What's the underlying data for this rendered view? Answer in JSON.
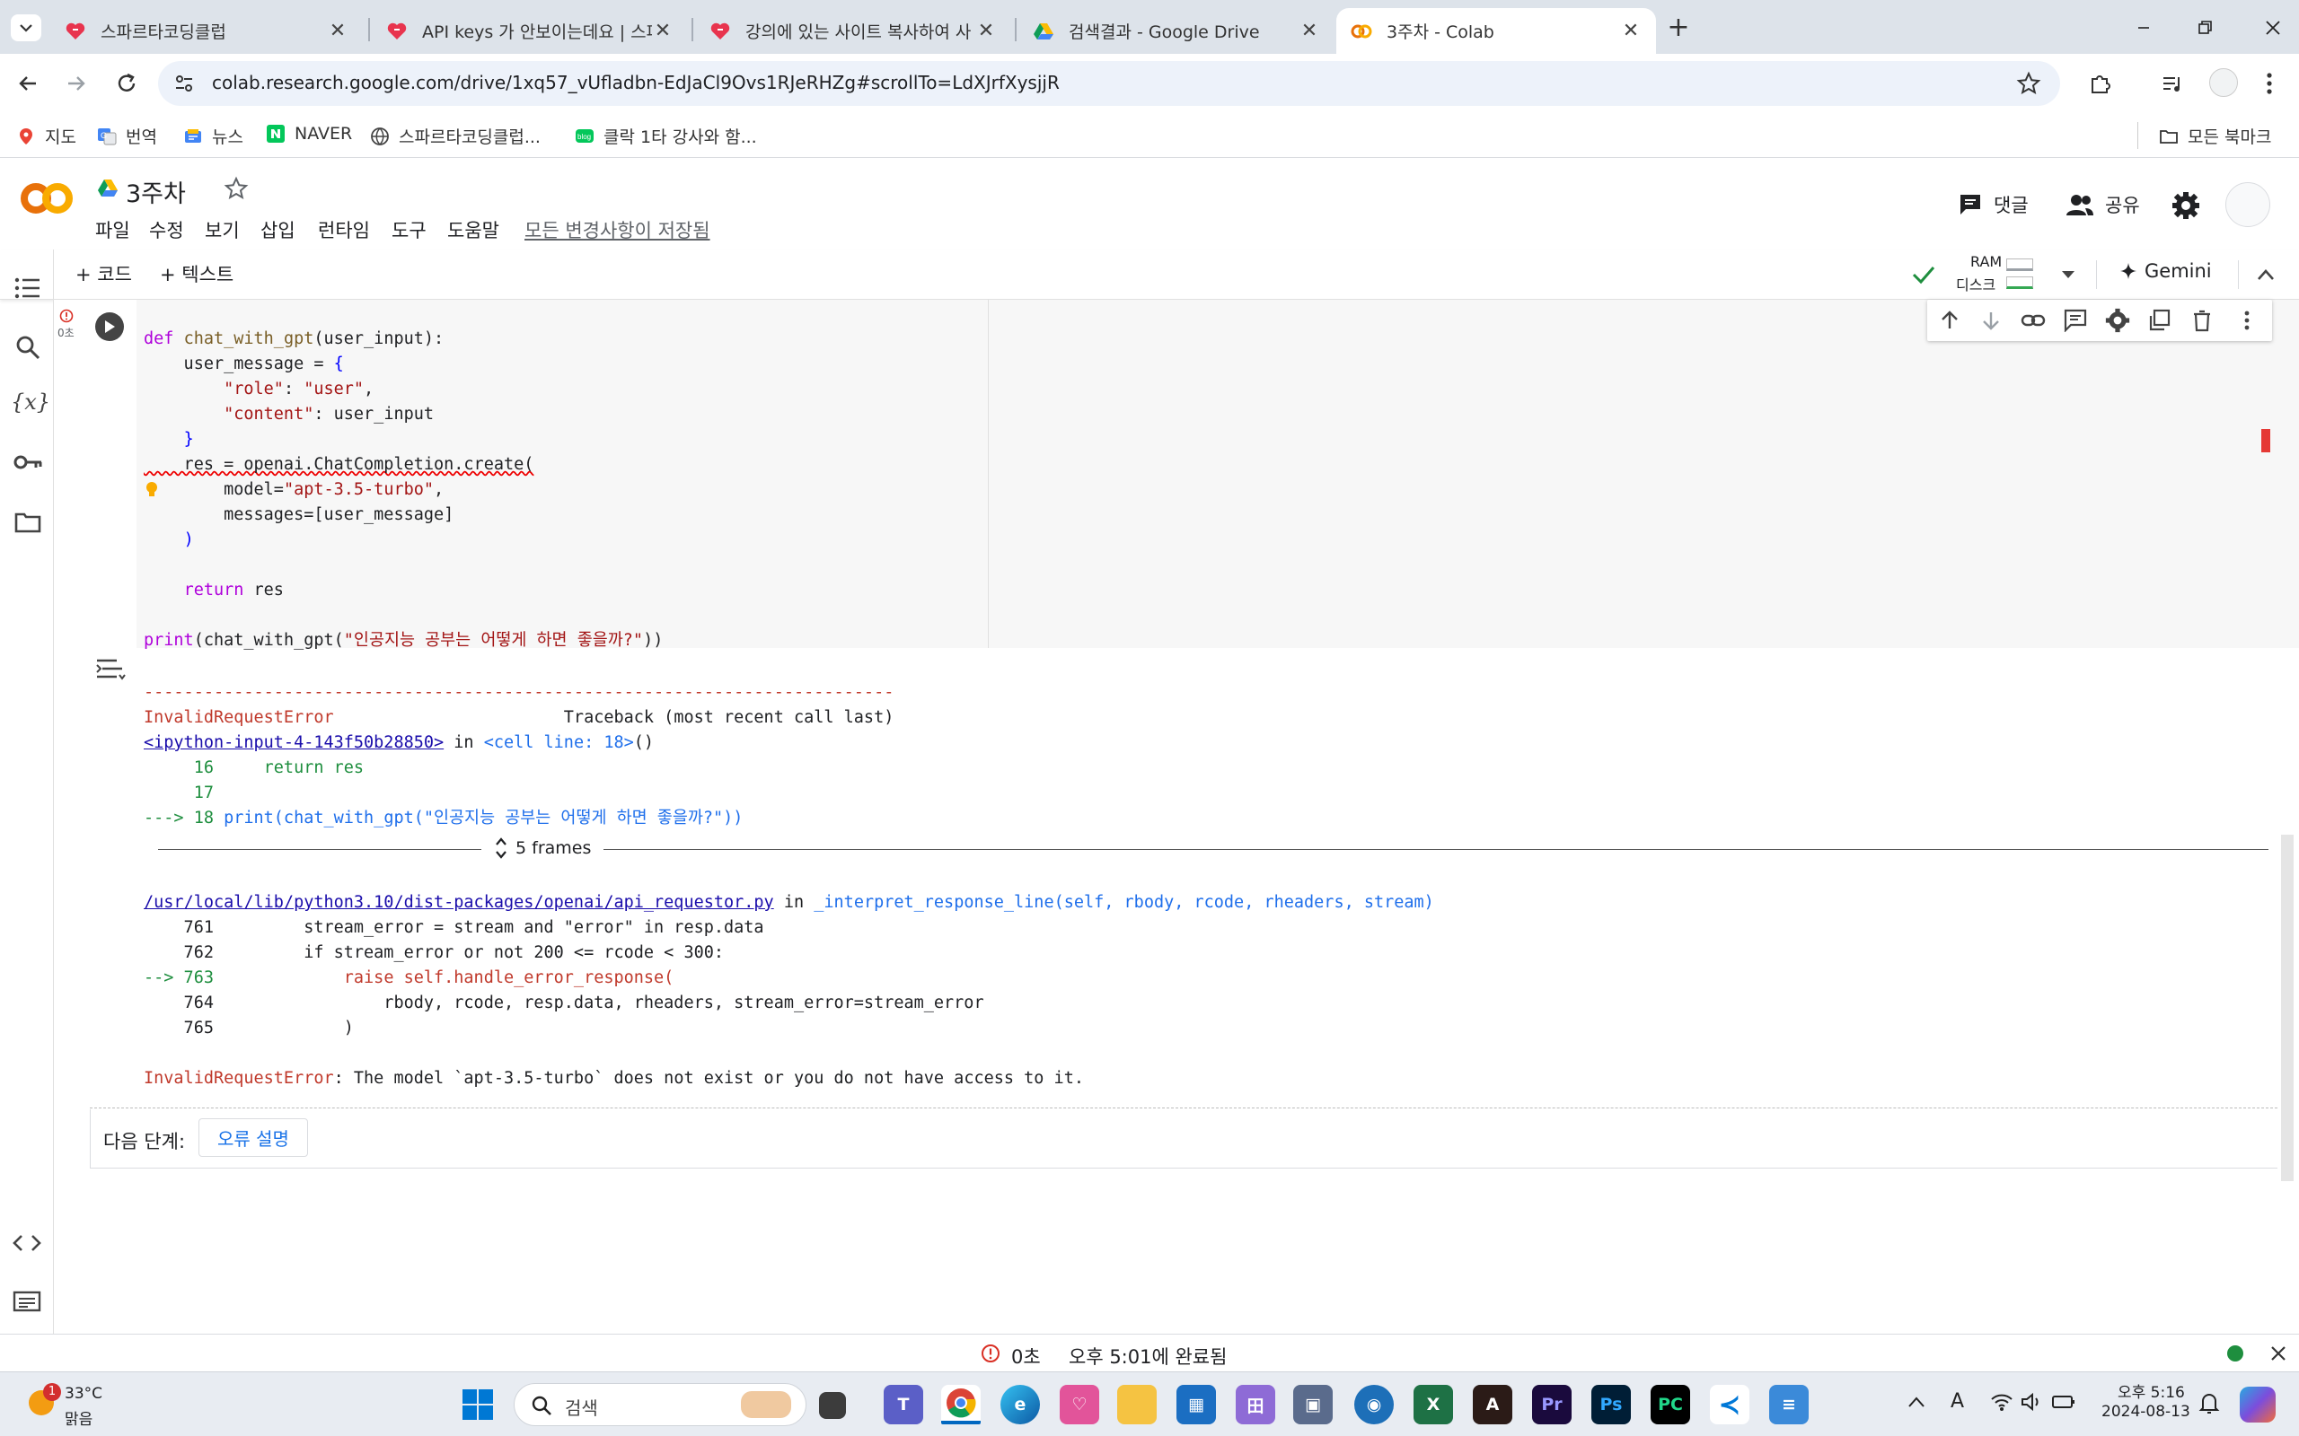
{
  "browser": {
    "tabs": [
      {
        "title": "스파르타코딩클럽",
        "active": false
      },
      {
        "title": "API keys 가 안보이는데요 | 스파르",
        "active": false
      },
      {
        "title": "강의에 있는 사이트 복사하여 사",
        "active": false
      },
      {
        "title": "검색결과 - Google Drive",
        "active": false
      },
      {
        "title": "3주차 - Colab",
        "active": true
      }
    ],
    "url": "colab.research.google.com/drive/1xq57_vUfladbn-EdJaCl9Ovs1RJeRHZg#scrollTo=LdXJrfXysjjR",
    "bookmarks": [
      "지도",
      "번역",
      "뉴스",
      "NAVER",
      "스파르타코딩클럽...",
      "클락 1타 강사와 함..."
    ],
    "all_bookmarks": "모든 북마크"
  },
  "colab": {
    "logo": "CO",
    "notebook_title": "3주차",
    "menu": [
      "파일",
      "수정",
      "보기",
      "삽입",
      "런타임",
      "도구",
      "도움말"
    ],
    "save_status": "모든 변경사항이 저장됨",
    "comment": "댓글",
    "share": "공유",
    "add_code": "+ 코드",
    "add_text": "+ 텍스트",
    "ram": "RAM",
    "disk": "디스크",
    "gemini": "Gemini",
    "exec_time": "0초",
    "next_steps_label": "다음 단계:",
    "explain_error": "오류 설명",
    "frames": "5 frames",
    "status_time": "0초",
    "status_done": "오후 5:01에 완료됨"
  },
  "code_lines": [
    "def chat_with_gpt(user_input):",
    "    user_message = {",
    "        \"role\": \"user\",",
    "        \"content\": user_input",
    "    }",
    "    res = openai.ChatCompletion.create(",
    "        model=\"apt-3.5-turbo\",",
    "        messages=[user_message]",
    "    )",
    "",
    "    return res",
    "",
    "print(chat_with_gpt(\"인공지능 공부는 어떻게 하면 좋을까?\"))"
  ],
  "output": {
    "dashes": "---------------------------------------------------------------------------",
    "err_name": "InvalidRequestError",
    "traceback": "                       Traceback (most recent call last)",
    "ipy_link": "<ipython-input-4-143f50b28850>",
    "in_word": " in ",
    "cell_line": "<cell line: 18>",
    "paren": "()",
    "l16": "     16     return res",
    "l17": "     17",
    "l18_arrow": "---> 18 ",
    "l18_code": "print(chat_with_gpt(\"인공지능 공부는 어떻게 하면 좋을까?\"))",
    "file_link": "/usr/local/lib/python3.10/dist-packages/openai/api_requestor.py",
    "func": "_interpret_response_line(self, rbody, rcode, rheaders, stream)",
    "l761": "    761         stream_error = stream and \"error\" in resp.data",
    "l762": "    762         if stream_error or not 200 <= rcode < 300:",
    "l763_arrow": "--> 763",
    "l763_code": "             raise self.handle_error_response(",
    "l764": "    764                 rbody, rcode, resp.data, rheaders, stream_error=stream_error",
    "l765": "    765             )",
    "final_name": "InvalidRequestError",
    "final_msg": ": The model `apt-3.5-turbo` does not exist or you do not have access to it."
  },
  "taskbar": {
    "weather_temp": "33°C",
    "weather_desc": "맑음",
    "weather_badge": "1",
    "search": "검색",
    "time": "오후 5:16",
    "date": "2024-08-13"
  },
  "colors": {
    "colab_orange": "#f9ab00",
    "error_red": "#d93025",
    "tab_bg": "#dde3ea",
    "link": "#1a0dab"
  }
}
